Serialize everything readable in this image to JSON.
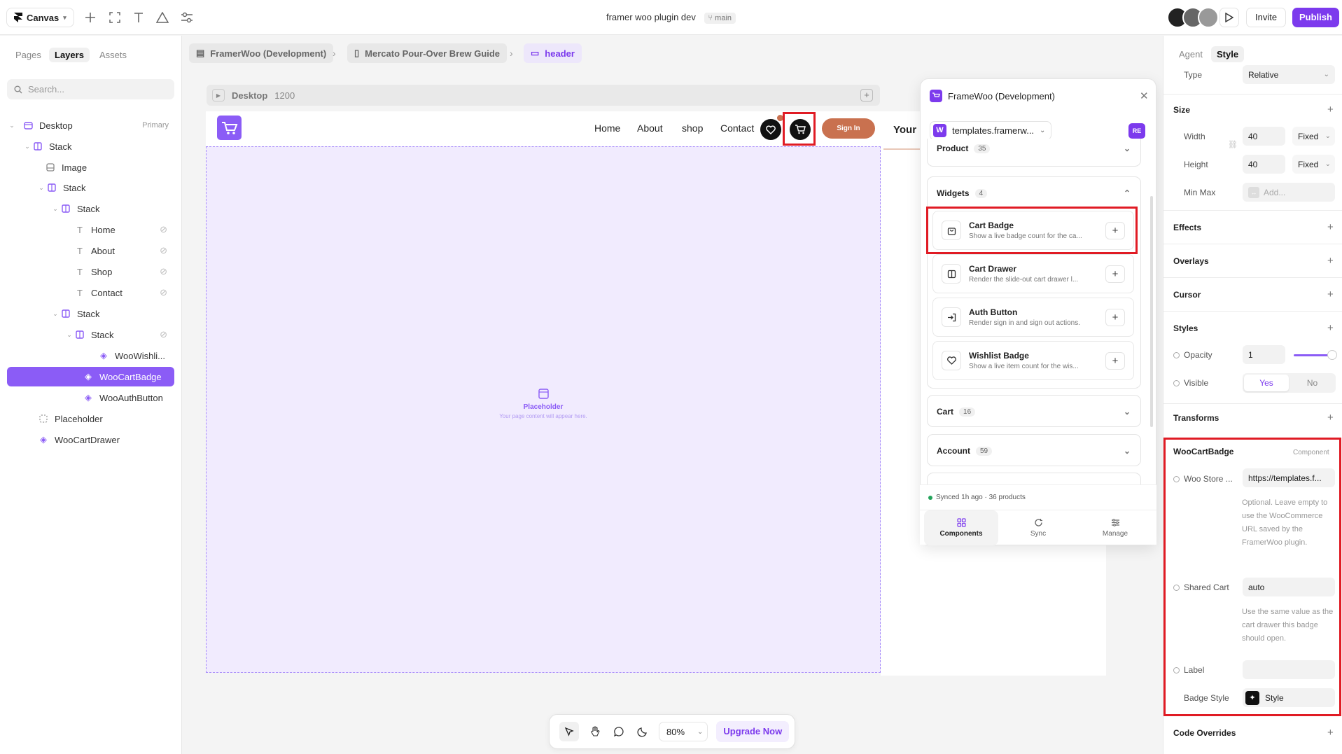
{
  "topbar": {
    "canvas_label": "Canvas",
    "project_title": "framer woo plugin dev",
    "branch": "main",
    "invite_label": "Invite",
    "publish_label": "Publish",
    "accent": "#7c3aed"
  },
  "left_panel": {
    "tabs": [
      "Pages",
      "Layers",
      "Assets"
    ],
    "active_tab": "Layers",
    "search_placeholder": "Search...",
    "primary_tag": "Primary",
    "layers": [
      {
        "label": "Desktop",
        "icon": "frame-icon"
      },
      {
        "label": "Stack",
        "icon": "stack-icon"
      },
      {
        "label": "Image",
        "icon": "image-icon"
      },
      {
        "label": "Stack",
        "icon": "stack-icon"
      },
      {
        "label": "Stack",
        "icon": "stack-icon"
      },
      {
        "label": "Home",
        "icon": "text-icon"
      },
      {
        "label": "About",
        "icon": "text-icon"
      },
      {
        "label": "Shop",
        "icon": "text-icon"
      },
      {
        "label": "Contact",
        "icon": "text-icon"
      },
      {
        "label": "Stack",
        "icon": "stack-icon"
      },
      {
        "label": "Stack",
        "icon": "stack-icon"
      },
      {
        "label": "WooWishli...",
        "icon": "component-icon"
      },
      {
        "label": "WooCartBadge",
        "icon": "component-icon"
      },
      {
        "label": "WooAuthButton",
        "icon": "component-icon"
      },
      {
        "label": "Placeholder",
        "icon": "placeholder-icon"
      },
      {
        "label": "WooCartDrawer",
        "icon": "component-icon"
      }
    ]
  },
  "breadcrumb": [
    "FramerWoo (Development)",
    "Mercato Pour-Over Brew Guide",
    "header"
  ],
  "canvas": {
    "frame_name": "Desktop",
    "frame_width": "1200",
    "nav_links": [
      "Home",
      "About",
      "shop",
      "Contact"
    ],
    "signin_label": "Sign In",
    "placeholder_title": "Placeholder",
    "placeholder_sub": "Your page content will appear here.",
    "right_text": "Your"
  },
  "plugin": {
    "title": "FrameWoo (Development)",
    "site": "templates.framerw...",
    "site_initial": "W",
    "user_initials": "RE",
    "sections": {
      "product": {
        "label": "Product",
        "count": "35"
      },
      "widgets": {
        "label": "Widgets",
        "count": "4"
      },
      "cart": {
        "label": "Cart",
        "count": "16"
      },
      "account": {
        "label": "Account",
        "count": "59"
      }
    },
    "widgets": [
      {
        "title": "Cart Badge",
        "desc": "Show a live badge count for the ca..."
      },
      {
        "title": "Cart Drawer",
        "desc": "Render the slide-out cart drawer l..."
      },
      {
        "title": "Auth Button",
        "desc": "Render sign in and sign out actions."
      },
      {
        "title": "Wishlist Badge",
        "desc": "Show a live item count for the wis..."
      }
    ],
    "status": "Synced 1h ago · 36 products",
    "tabs": [
      "Components",
      "Sync",
      "Manage"
    ],
    "active_tab": "Components"
  },
  "bottombar": {
    "zoom": "80%",
    "upgrade_label": "Upgrade Now"
  },
  "right_panel": {
    "tabs": [
      "Agent",
      "Style"
    ],
    "active_tab": "Style",
    "type_label": "Type",
    "type_value": "Relative",
    "size_label": "Size",
    "width_label": "Width",
    "width_value": "40",
    "width_mode": "Fixed",
    "height_label": "Height",
    "height_value": "40",
    "height_mode": "Fixed",
    "minmax_label": "Min Max",
    "minmax_placeholder": "Add...",
    "effects": "Effects",
    "overlays": "Overlays",
    "cursor": "Cursor",
    "styles": "Styles",
    "opacity_label": "Opacity",
    "opacity_value": "1",
    "visible_label": "Visible",
    "visible_yes": "Yes",
    "visible_no": "No",
    "transforms": "Transforms",
    "component_name": "WooCartBadge",
    "component_tag": "Component",
    "store_label": "Woo Store ...",
    "store_value": "https://templates.f...",
    "store_help": "Optional. Leave empty to use the WooCommerce URL saved by the FramerWoo plugin.",
    "shared_cart_label": "Shared Cart",
    "shared_cart_value": "auto",
    "shared_cart_help": "Use the same value as the cart drawer this badge should open.",
    "label_label": "Label",
    "badge_style_label": "Badge Style",
    "badge_style_value": "Style",
    "code_overrides": "Code Overrides"
  }
}
